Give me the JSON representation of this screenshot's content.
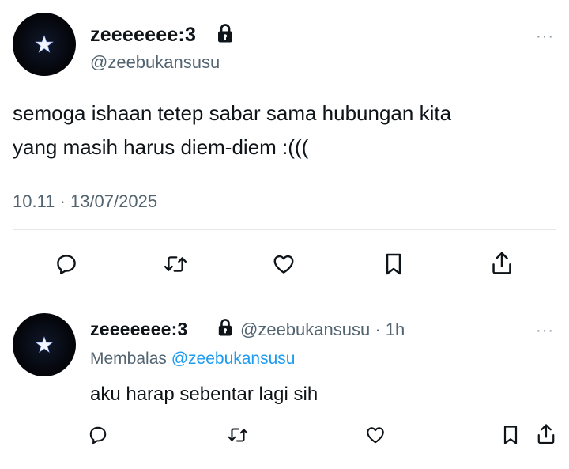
{
  "main_tweet": {
    "display_name": "zeeeeeee:3",
    "handle": "@zeebukansusu",
    "text_line1": "semoga ishaan tetep sabar sama hubungan kita",
    "text_line2": "yang masih harus diem-diem :(((",
    "timestamp": "10.11 · 13/07/2025",
    "more_label": "···"
  },
  "reply": {
    "display_name": "zeeeeeee:3",
    "handle": "@zeebukansusu",
    "time_sep": "·",
    "time": "1h",
    "replying_prefix": "Membalas",
    "replying_handle": "@zeebukansusu",
    "text": "aku harap sebentar lagi sih",
    "more_label": "···"
  },
  "icons": [
    "star-avatar",
    "lock-icon",
    "reply-icon",
    "retweet-icon",
    "like-icon",
    "bookmark-icon",
    "share-icon",
    "more-icon"
  ],
  "colors": {
    "text": "#0f1419",
    "secondary": "#536471",
    "link": "#1d9bf0",
    "divider": "#e5e7e9"
  }
}
